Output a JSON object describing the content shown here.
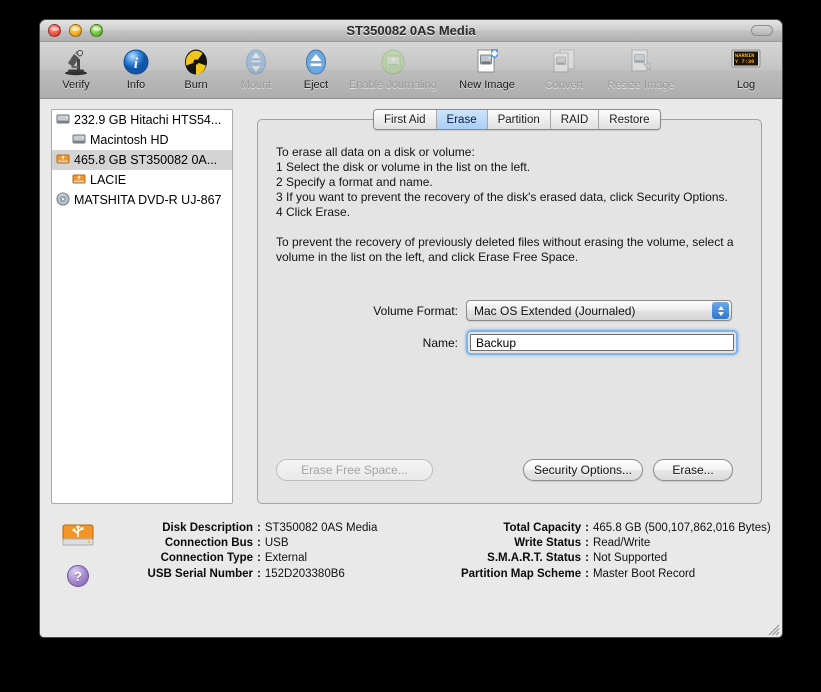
{
  "window": {
    "title": "ST350082 0AS Media",
    "controls": [
      "close-button",
      "minimize-button",
      "zoom-button"
    ]
  },
  "toolbar": {
    "items": [
      {
        "label": "Verify",
        "icon": "microscope-icon",
        "enabled": true
      },
      {
        "label": "Info",
        "icon": "info-icon",
        "enabled": true
      },
      {
        "label": "Burn",
        "icon": "burn-radiation-icon",
        "enabled": true
      },
      {
        "label": "Mount",
        "icon": "mount-icon",
        "enabled": false
      },
      {
        "label": "Eject",
        "icon": "eject-icon",
        "enabled": true
      },
      {
        "label": "Enable Journaling",
        "icon": "journaling-icon",
        "enabled": false
      },
      {
        "label": "New Image",
        "icon": "new-image-icon",
        "enabled": true
      },
      {
        "label": "Convert",
        "icon": "convert-icon",
        "enabled": false
      },
      {
        "label": "Resize Image",
        "icon": "resize-image-icon",
        "enabled": false
      }
    ],
    "log": {
      "label": "Log",
      "icon": "log-console-icon",
      "screen_text_line1": "WARNIN",
      "screen_text_line2": "Y 7:36"
    }
  },
  "sidebar": {
    "rows": [
      {
        "label": "232.9 GB Hitachi HTS54...",
        "icon": "internal-disk-icon",
        "indent": false,
        "selected": false
      },
      {
        "label": "Macintosh HD",
        "icon": "volume-icon",
        "indent": true,
        "selected": false
      },
      {
        "label": "465.8 GB ST350082 0A...",
        "icon": "usb-disk-icon",
        "indent": false,
        "selected": true
      },
      {
        "label": "LACIE",
        "icon": "usb-volume-icon",
        "indent": true,
        "selected": false
      },
      {
        "label": "MATSHITA DVD-R UJ-867",
        "icon": "optical-drive-icon",
        "indent": false,
        "selected": false
      }
    ]
  },
  "tabs": [
    {
      "label": "First Aid",
      "active": false
    },
    {
      "label": "Erase",
      "active": true
    },
    {
      "label": "Partition",
      "active": false
    },
    {
      "label": "RAID",
      "active": false
    },
    {
      "label": "Restore",
      "active": false
    }
  ],
  "erase_panel": {
    "instructions": [
      "To erase all data on a disk or volume:",
      "1  Select the disk or volume in the list on the left.",
      "2  Specify a format and name.",
      "3  If you want to prevent the recovery of the disk's erased data, click Security Options.",
      "4  Click Erase.",
      "",
      "To prevent the recovery of previously deleted files without erasing the volume, select a",
      "volume in the list on the left, and click Erase Free Space."
    ],
    "volume_format": {
      "label": "Volume Format:",
      "value": "Mac OS Extended (Journaled)"
    },
    "name": {
      "label": "Name:",
      "value": "Backup",
      "placeholder": "",
      "focused": true
    },
    "buttons": {
      "erase_free_space": {
        "label": "Erase Free Space...",
        "enabled": false
      },
      "security_options": {
        "label": "Security Options...",
        "enabled": true
      },
      "erase": {
        "label": "Erase...",
        "enabled": true
      }
    }
  },
  "info": {
    "disk_icon": "usb-drive-icon",
    "help_label": "?",
    "left": [
      {
        "key": "Disk Description",
        "value": "ST350082 0AS Media"
      },
      {
        "key": "Connection Bus",
        "value": "USB"
      },
      {
        "key": "Connection Type",
        "value": "External"
      },
      {
        "key": "USB Serial Number",
        "value": "152D203380B6"
      }
    ],
    "right": [
      {
        "key": "Total Capacity",
        "value": "465.8 GB (500,107,862,016 Bytes)"
      },
      {
        "key": "Write Status",
        "value": "Read/Write"
      },
      {
        "key": "S.M.A.R.T. Status",
        "value": "Not Supported"
      },
      {
        "key": "Partition Map Scheme",
        "value": "Master Boot Record"
      }
    ]
  },
  "colors": {
    "accent_blue": "#a9cdf6",
    "focus_ring": "#6eaaeb",
    "usb_orange": "#f2962a",
    "help_purple": "#a58ad0"
  }
}
